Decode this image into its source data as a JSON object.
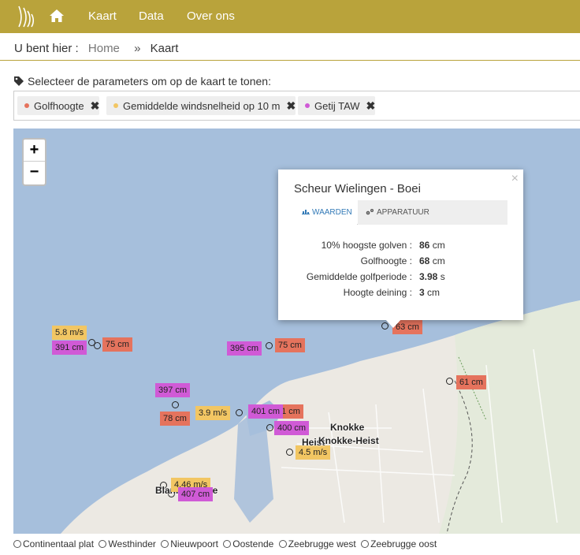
{
  "nav": {
    "links": [
      "Kaart",
      "Data",
      "Over ons"
    ]
  },
  "breadcrumb": {
    "prefix": "U bent hier :",
    "home": "Home",
    "separator": "»",
    "current": "Kaart"
  },
  "parameters": {
    "title": "Selecteer de parameters om op de kaart te tonen:",
    "chips": [
      {
        "label": "Golfhoogte",
        "color": "#e5735d"
      },
      {
        "label": "Gemiddelde windsnelheid op 10 m",
        "color": "#f2c663"
      },
      {
        "label": "Getij TAW",
        "color": "#d05ad6"
      }
    ],
    "remove_glyph": "✖"
  },
  "map": {
    "zoom_in": "+",
    "zoom_out": "−",
    "labels": [
      {
        "text": "5.8 m/s",
        "kind": "w"
      },
      {
        "text": "391 cm",
        "kind": "t"
      },
      {
        "text": "75 cm",
        "kind": "g"
      },
      {
        "text": "395 cm",
        "kind": "t"
      },
      {
        "text": "75 cm",
        "kind": "g"
      },
      {
        "text": "63 cm",
        "kind": "g"
      },
      {
        "text": "61 cm",
        "kind": "g"
      },
      {
        "text": "397 cm",
        "kind": "t"
      },
      {
        "text": "78 cm",
        "kind": "g"
      },
      {
        "text": "3.9 m/s",
        "kind": "w"
      },
      {
        "text": "71 cm",
        "kind": "g"
      },
      {
        "text": "401 cm",
        "kind": "t"
      },
      {
        "text": "400 cm",
        "kind": "t"
      },
      {
        "text": "4.5 m/s",
        "kind": "w"
      },
      {
        "text": "4.46 m/s",
        "kind": "w"
      },
      {
        "text": "407 cm",
        "kind": "t"
      }
    ],
    "places": [
      "Knokke",
      "Heist",
      "Knokke-Heist",
      "Blankenberge"
    ]
  },
  "popup": {
    "close": "×",
    "title": "Scheur Wielingen - Boei",
    "tab_values": "WAARDEN",
    "tab_equipment": "APPARATUUR",
    "rows": [
      {
        "label": "10% hoogste golven :",
        "value": "86",
        "unit": "cm"
      },
      {
        "label": "Golfhoogte :",
        "value": "68",
        "unit": "cm"
      },
      {
        "label": "Gemiddelde golfperiode :",
        "value": "3.98",
        "unit": "s"
      },
      {
        "label": "Hoogte deining :",
        "value": "3",
        "unit": "cm"
      }
    ]
  },
  "stations": [
    "Continentaal plat",
    "Westhinder",
    "Nieuwpoort",
    "Oostende",
    "Zeebrugge west",
    "Zeebrugge oost"
  ]
}
